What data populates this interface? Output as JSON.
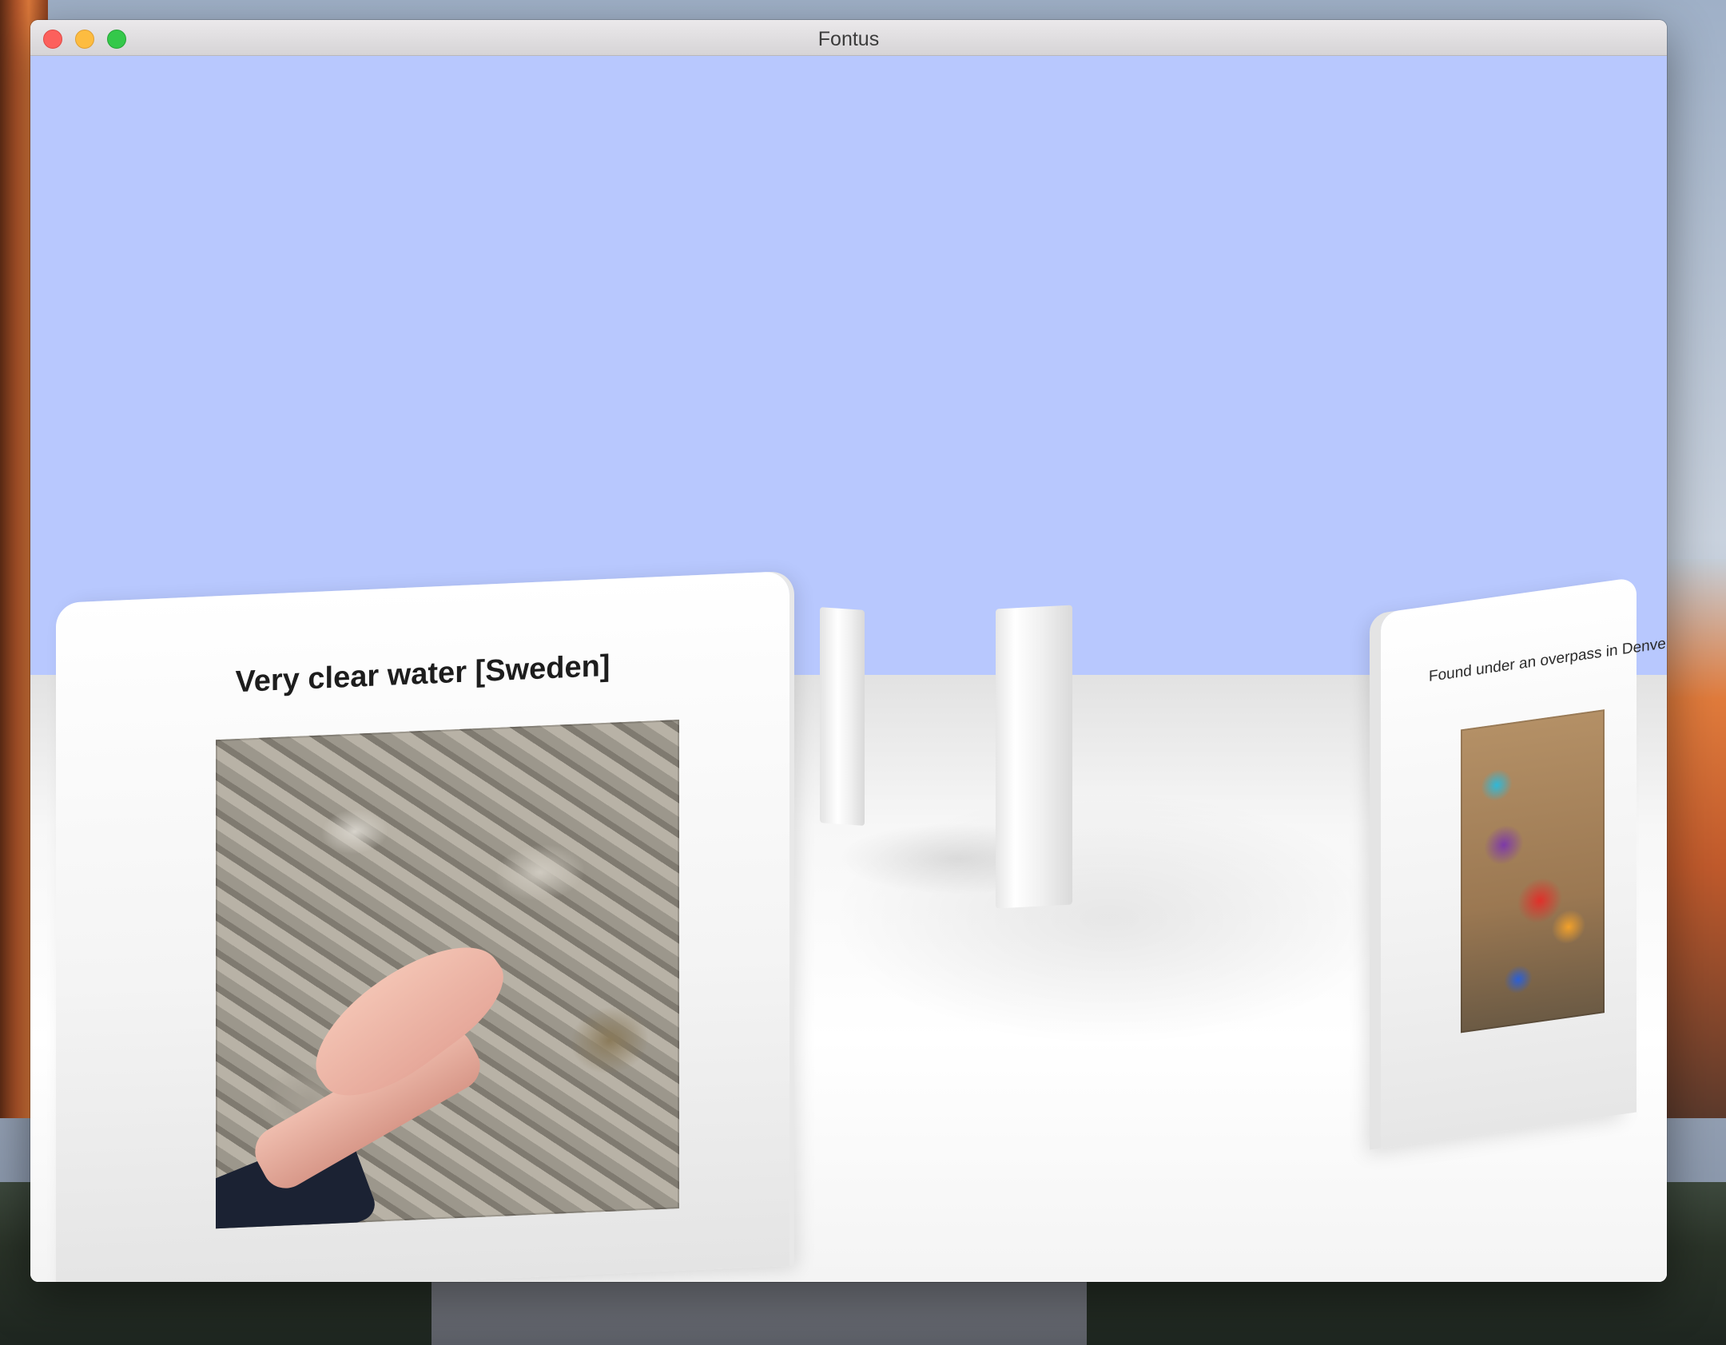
{
  "window": {
    "title": "Fontus"
  },
  "scene": {
    "colors": {
      "sky": "#b8c8fe",
      "floor": "#f4f4f4",
      "panel": "#ffffff"
    },
    "panels": [
      {
        "caption": "Very clear water [Sweden]",
        "photo": "hand-in-clear-water-over-rocks"
      },
      {
        "caption": "Found under an overpass in Denver",
        "photo": "graffiti-mural"
      }
    ]
  }
}
